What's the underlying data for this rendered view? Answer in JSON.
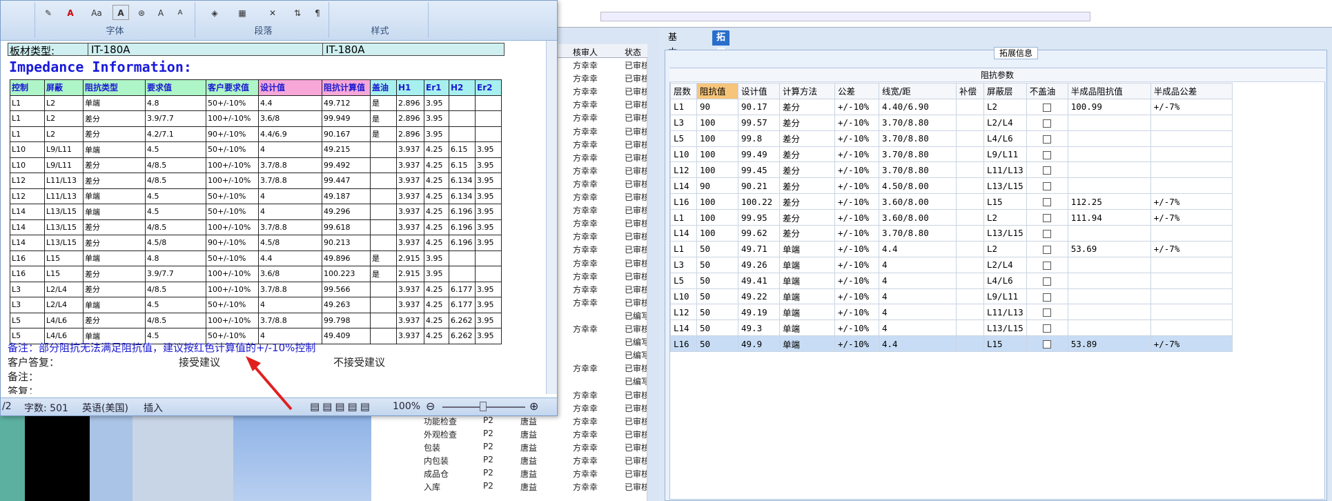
{
  "word": {
    "ribbon": {
      "groups": [
        "字体",
        "段落",
        "样式"
      ],
      "font_buttons": [
        "A",
        "Aa",
        "A",
        "A",
        "A"
      ]
    },
    "doc": {
      "plate_label": "板材类型:",
      "plate_value1": "IT-180A",
      "plate_value2": "IT-180A",
      "title": "Impedance Information:",
      "headers": [
        "控制",
        "屏蔽",
        "阻抗类型",
        "要求值",
        "客户要求值",
        "设计值",
        "阻抗计算值",
        "盖油",
        "H1",
        "Er1",
        "H2",
        "Er2"
      ],
      "rows": [
        [
          "L1",
          "L2",
          "单端",
          "4.8",
          "50+/-10%",
          "4.4",
          "49.712",
          "是",
          "2.896",
          "3.95",
          "",
          ""
        ],
        [
          "L1",
          "L2",
          "差分",
          "3.9/7.7",
          "100+/-10%",
          "3.6/8",
          "99.949",
          "是",
          "2.896",
          "3.95",
          "",
          ""
        ],
        [
          "L1",
          "L2",
          "差分",
          "4.2/7.1",
          "90+/-10%",
          "4.4/6.9",
          "90.167",
          "是",
          "2.896",
          "3.95",
          "",
          ""
        ],
        [
          "L10",
          "L9/L11",
          "单端",
          "4.5",
          "50+/-10%",
          "4",
          "49.215",
          "",
          "3.937",
          "4.25",
          "6.15",
          "3.95"
        ],
        [
          "L10",
          "L9/L11",
          "差分",
          "4/8.5",
          "100+/-10%",
          "3.7/8.8",
          "99.492",
          "",
          "3.937",
          "4.25",
          "6.15",
          "3.95"
        ],
        [
          "L12",
          "L11/L13",
          "差分",
          "4/8.5",
          "100+/-10%",
          "3.7/8.8",
          "99.447",
          "",
          "3.937",
          "4.25",
          "6.134",
          "3.95"
        ],
        [
          "L12",
          "L11/L13",
          "单端",
          "4.5",
          "50+/-10%",
          "4",
          "49.187",
          "",
          "3.937",
          "4.25",
          "6.134",
          "3.95"
        ],
        [
          "L14",
          "L13/L15",
          "单端",
          "4.5",
          "50+/-10%",
          "4",
          "49.296",
          "",
          "3.937",
          "4.25",
          "6.196",
          "3.95"
        ],
        [
          "L14",
          "L13/L15",
          "差分",
          "4/8.5",
          "100+/-10%",
          "3.7/8.8",
          "99.618",
          "",
          "3.937",
          "4.25",
          "6.196",
          "3.95"
        ],
        [
          "L14",
          "L13/L15",
          "差分",
          "4.5/8",
          "90+/-10%",
          "4.5/8",
          "90.213",
          "",
          "3.937",
          "4.25",
          "6.196",
          "3.95"
        ],
        [
          "L16",
          "L15",
          "单端",
          "4.8",
          "50+/-10%",
          "4.4",
          "49.896",
          "是",
          "2.915",
          "3.95",
          "",
          ""
        ],
        [
          "L16",
          "L15",
          "差分",
          "3.9/7.7",
          "100+/-10%",
          "3.6/8",
          "100.223",
          "是",
          "2.915",
          "3.95",
          "",
          ""
        ],
        [
          "L3",
          "L2/L4",
          "差分",
          "4/8.5",
          "100+/-10%",
          "3.7/8.8",
          "99.566",
          "",
          "3.937",
          "4.25",
          "6.177",
          "3.95"
        ],
        [
          "L3",
          "L2/L4",
          "单端",
          "4.5",
          "50+/-10%",
          "4",
          "49.263",
          "",
          "3.937",
          "4.25",
          "6.177",
          "3.95"
        ],
        [
          "L5",
          "L4/L6",
          "差分",
          "4/8.5",
          "100+/-10%",
          "3.7/8.8",
          "99.798",
          "",
          "3.937",
          "4.25",
          "6.262",
          "3.95"
        ],
        [
          "L5",
          "L4/L6",
          "单端",
          "4.5",
          "50+/-10%",
          "4",
          "49.409",
          "",
          "3.937",
          "4.25",
          "6.262",
          "3.95"
        ]
      ],
      "note": "备注：部分阻抗无法满足阻抗值，建议按红色计算值的+/-10%控制",
      "customer_reply": "客户答复：",
      "accept": "接受建议",
      "reject": "不接受建议",
      "remark": "备注：",
      "reply": "答复："
    },
    "status": {
      "page": "/2",
      "words": "字数: 501",
      "lang": "英语(美国)",
      "mode": "插入",
      "zoom": "100%"
    }
  },
  "list": {
    "header": [
      "核审人",
      "状态"
    ],
    "rows": [
      {
        "name": "",
        "p": "",
        "c": "",
        "r": "方幸幸",
        "s": "已审核"
      },
      {
        "name": "",
        "p": "",
        "c": "",
        "r": "方幸幸",
        "s": "已审核"
      },
      {
        "name": "",
        "p": "",
        "c": "",
        "r": "方幸幸",
        "s": "已审核"
      },
      {
        "name": "",
        "p": "",
        "c": "",
        "r": "方幸幸",
        "s": "已审核"
      },
      {
        "name": "",
        "p": "",
        "c": "",
        "r": "方幸幸",
        "s": "已审核"
      },
      {
        "name": "",
        "p": "",
        "c": "",
        "r": "方幸幸",
        "s": "已审核"
      },
      {
        "name": "",
        "p": "",
        "c": "",
        "r": "方幸幸",
        "s": "已审核"
      },
      {
        "name": "",
        "p": "",
        "c": "",
        "r": "方幸幸",
        "s": "已审核"
      },
      {
        "name": "",
        "p": "",
        "c": "",
        "r": "方幸幸",
        "s": "已审核"
      },
      {
        "name": "",
        "p": "",
        "c": "",
        "r": "方幸幸",
        "s": "已审核"
      },
      {
        "name": "",
        "p": "",
        "c": "",
        "r": "方幸幸",
        "s": "已审核"
      },
      {
        "name": "",
        "p": "",
        "c": "",
        "r": "方幸幸",
        "s": "已审核"
      },
      {
        "name": "",
        "p": "",
        "c": "",
        "r": "方幸幸",
        "s": "已审核"
      },
      {
        "name": "",
        "p": "",
        "c": "",
        "r": "方幸幸",
        "s": "已审核"
      },
      {
        "name": "",
        "p": "",
        "c": "",
        "r": "方幸幸",
        "s": "已审核"
      },
      {
        "name": "",
        "p": "",
        "c": "",
        "r": "方幸幸",
        "s": "已审核"
      },
      {
        "name": "",
        "p": "",
        "c": "",
        "r": "方幸幸",
        "s": "已审核"
      },
      {
        "name": "",
        "p": "",
        "c": "",
        "r": "方幸幸",
        "s": "已审核"
      },
      {
        "name": "",
        "p": "",
        "c": "",
        "r": "方幸幸",
        "s": "已审核"
      },
      {
        "name": "",
        "p": "",
        "c": "",
        "r": "",
        "s": "已编写"
      },
      {
        "name": "",
        "p": "",
        "c": "",
        "r": "方幸幸",
        "s": "已审核"
      },
      {
        "name": "",
        "p": "",
        "c": "",
        "r": "",
        "s": "已编写"
      },
      {
        "name": "",
        "p": "",
        "c": "",
        "r": "",
        "s": "已编写"
      },
      {
        "name": "",
        "p": "",
        "c": "",
        "r": "方幸幸",
        "s": "已审核"
      },
      {
        "name": "",
        "p": "",
        "c": "",
        "r": "",
        "s": "已编写"
      },
      {
        "name": "",
        "p": "",
        "c": "",
        "r": "方幸幸",
        "s": "已审核"
      },
      {
        "name": "",
        "p": "",
        "c": "",
        "r": "方幸幸",
        "s": "已审核"
      },
      {
        "name": "功能检查",
        "p": "P2",
        "c": "唐益",
        "r": "方幸幸",
        "s": "已审核"
      },
      {
        "name": "外观检查",
        "p": "P2",
        "c": "唐益",
        "r": "方幸幸",
        "s": "已审核"
      },
      {
        "name": "包装",
        "p": "P2",
        "c": "唐益",
        "r": "方幸幸",
        "s": "已审核"
      },
      {
        "name": "内包装",
        "p": "P2",
        "c": "唐益",
        "r": "方幸幸",
        "s": "已审核"
      },
      {
        "name": "成品仓",
        "p": "P2",
        "c": "唐益",
        "r": "方幸幸",
        "s": "已审核"
      },
      {
        "name": "入库",
        "p": "P2",
        "c": "唐益",
        "r": "方幸幸",
        "s": "已审核"
      }
    ]
  },
  "right": {
    "tabs": [
      "基本信息",
      "拓展信息"
    ],
    "ext_label": "拓展信息",
    "section_title": "阻抗参数",
    "headers": [
      "层数",
      "阻抗值",
      "设计值",
      "计算方法",
      "公差",
      "线宽/距",
      "补偿",
      "屏蔽层",
      "不盖油",
      "半成品阻抗值",
      "半成品公差"
    ],
    "rows": [
      [
        "L1",
        "90",
        "90.17",
        "差分",
        "+/-10%",
        "4.40/6.90",
        "",
        "L2",
        "",
        "100.99",
        "+/-7%"
      ],
      [
        "L3",
        "100",
        "99.57",
        "差分",
        "+/-10%",
        "3.70/8.80",
        "",
        "L2/L4",
        "",
        "",
        ""
      ],
      [
        "L5",
        "100",
        "99.8",
        "差分",
        "+/-10%",
        "3.70/8.80",
        "",
        "L4/L6",
        "",
        "",
        ""
      ],
      [
        "L10",
        "100",
        "99.49",
        "差分",
        "+/-10%",
        "3.70/8.80",
        "",
        "L9/L11",
        "",
        "",
        ""
      ],
      [
        "L12",
        "100",
        "99.45",
        "差分",
        "+/-10%",
        "3.70/8.80",
        "",
        "L11/L13",
        "",
        "",
        ""
      ],
      [
        "L14",
        "90",
        "90.21",
        "差分",
        "+/-10%",
        "4.50/8.00",
        "",
        "L13/L15",
        "",
        "",
        ""
      ],
      [
        "L16",
        "100",
        "100.22",
        "差分",
        "+/-10%",
        "3.60/8.00",
        "",
        "L15",
        "",
        "112.25",
        "+/-7%"
      ],
      [
        "L1",
        "100",
        "99.95",
        "差分",
        "+/-10%",
        "3.60/8.00",
        "",
        "L2",
        "",
        "111.94",
        "+/-7%"
      ],
      [
        "L14",
        "100",
        "99.62",
        "差分",
        "+/-10%",
        "3.70/8.80",
        "",
        "L13/L15",
        "",
        "",
        ""
      ],
      [
        "L1",
        "50",
        "49.71",
        "单端",
        "+/-10%",
        "4.4",
        "",
        "L2",
        "",
        "53.69",
        "+/-7%"
      ],
      [
        "L3",
        "50",
        "49.26",
        "单端",
        "+/-10%",
        "4",
        "",
        "L2/L4",
        "",
        "",
        ""
      ],
      [
        "L5",
        "50",
        "49.41",
        "单端",
        "+/-10%",
        "4",
        "",
        "L4/L6",
        "",
        "",
        ""
      ],
      [
        "L10",
        "50",
        "49.22",
        "单端",
        "+/-10%",
        "4",
        "",
        "L9/L11",
        "",
        "",
        ""
      ],
      [
        "L12",
        "50",
        "49.19",
        "单端",
        "+/-10%",
        "4",
        "",
        "L11/L13",
        "",
        "",
        ""
      ],
      [
        "L14",
        "50",
        "49.3",
        "单端",
        "+/-10%",
        "4",
        "",
        "L13/L15",
        "",
        "",
        ""
      ],
      [
        "L16",
        "50",
        "49.9",
        "单端",
        "+/-10%",
        "4.4",
        "",
        "L15",
        "",
        "53.89",
        "+/-7%"
      ]
    ]
  },
  "colors": {
    "accent": "#2a6ecb",
    "title_blue": "#1a1adc",
    "arrow_red": "#e02020",
    "header_pink": "#f7a8d8",
    "header_green": "#aef5c8",
    "header_cyan": "#a8f0f0"
  }
}
